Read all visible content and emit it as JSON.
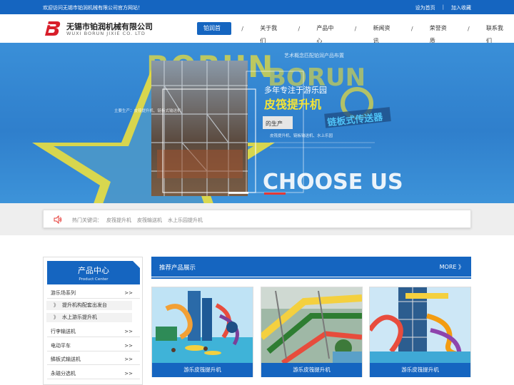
{
  "topbar": {
    "welcome": "欢迎访问无锡市铂润机械有限公司官方网站！",
    "set_home": "设为首页",
    "separator": "|",
    "add_favorite": "加入收藏"
  },
  "header": {
    "company_cn": "无锡市铂润机械有限公司",
    "company_en": "WUXI BORUN JIXIE CO. LTD",
    "nav": [
      {
        "label": "铂润首页"
      },
      {
        "label": "关于我们"
      },
      {
        "label": "产品中心"
      },
      {
        "label": "新闻资讯"
      },
      {
        "label": "荣誉资质"
      },
      {
        "label": "联系我们"
      }
    ],
    "nav_separator": "/"
  },
  "banner": {
    "line1": "艺术概念匹配铂润产品布置",
    "line2": "多年专注于游乐园",
    "line3": "皮筏提升机",
    "line4": "链板式传送器",
    "line5": "的生产",
    "side_left": "主要生产：皮筏提升机、链板式输送机",
    "side_right": "皮筏提升机、链板输送机、水上乐园",
    "choose": "CHOOSE US",
    "brand": "BORUN"
  },
  "hot": {
    "label": "热门关键词：",
    "keywords": [
      "皮筏提升机",
      "皮筏输送机",
      "水上乐园提升机"
    ]
  },
  "sidebar": {
    "title": "产品中心",
    "subtitle": "Product Center",
    "items": [
      {
        "label": "游乐场系列",
        "arrow": ">>"
      },
      {
        "label": "行李输送机",
        "arrow": ">>"
      },
      {
        "label": "电动平车",
        "arrow": ">>"
      },
      {
        "label": "鳞板式输送机",
        "arrow": ">>"
      },
      {
        "label": "永磁分选机",
        "arrow": ">>"
      }
    ],
    "subitems": [
      {
        "label": "提升机构配套出发台",
        "mark": "》"
      },
      {
        "label": "水上游乐提升机",
        "mark": "》"
      }
    ]
  },
  "recommend": {
    "title": "推荐产品展示",
    "more": "MORE",
    "more_icon": "》",
    "products": [
      {
        "caption": "游乐皮筏提升机"
      },
      {
        "caption": "游乐皮筏提升机"
      },
      {
        "caption": "游乐皮筏提升机"
      }
    ]
  },
  "colors": {
    "brand_blue": "#1565c0",
    "logo_red": "#d81e2a"
  }
}
